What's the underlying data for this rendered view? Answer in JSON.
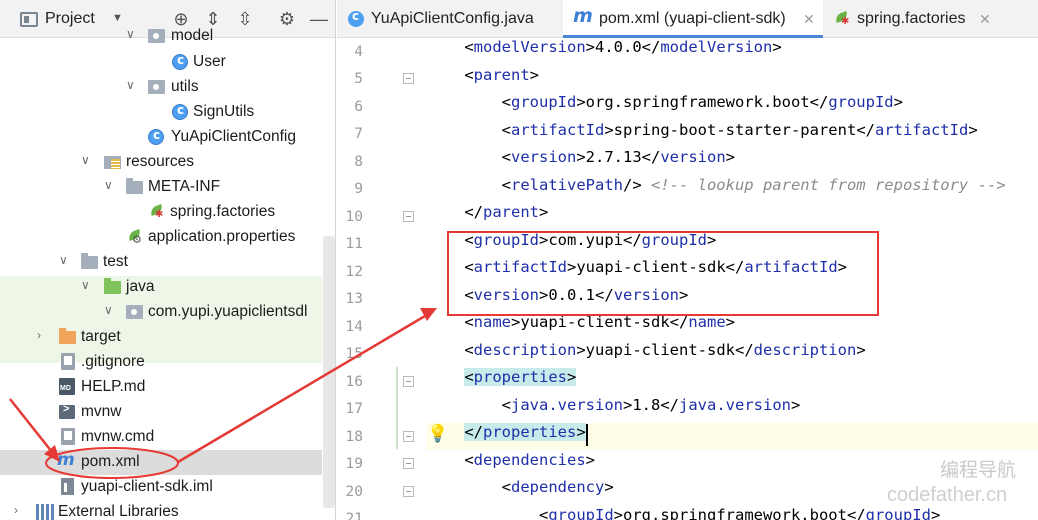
{
  "project_panel": {
    "title": "Project",
    "tree": [
      {
        "label": "model"
      },
      {
        "label": "User"
      },
      {
        "label": "utils"
      },
      {
        "label": "SignUtils"
      },
      {
        "label": "YuApiClientConfig"
      },
      {
        "label": "resources"
      },
      {
        "label": "META-INF"
      },
      {
        "label": "spring.factories"
      },
      {
        "label": "application.properties"
      },
      {
        "label": "test"
      },
      {
        "label": "java"
      },
      {
        "label": "com.yupi.yuapiclientsdl"
      },
      {
        "label": "target"
      },
      {
        "label": ".gitignore"
      },
      {
        "label": "HELP.md"
      },
      {
        "label": "mvnw"
      },
      {
        "label": "mvnw.cmd"
      },
      {
        "label": "pom.xml"
      },
      {
        "label": "yuapi-client-sdk.iml"
      },
      {
        "label": "External Libraries"
      }
    ]
  },
  "tabs": [
    {
      "label": "YuApiClientConfig.java"
    },
    {
      "label": "pom.xml (yuapi-client-sdk)"
    },
    {
      "label": "spring.factories"
    }
  ],
  "editor": {
    "line_numbers": [
      "4",
      "5",
      "6",
      "7",
      "8",
      "9",
      "10",
      "11",
      "12",
      "13",
      "14",
      "15",
      "16",
      "17",
      "18",
      "19",
      "20",
      "21"
    ],
    "code": {
      "l4": {
        "tag": "modelVersion",
        "val": "4.0.0"
      },
      "l5": {
        "tag": "parent"
      },
      "l6": {
        "tag": "groupId",
        "val": "org.springframework.boot"
      },
      "l7": {
        "tag": "artifactId",
        "val": "spring-boot-starter-parent"
      },
      "l8": {
        "tag": "version",
        "val": "2.7.13"
      },
      "l9": {
        "tag": "relativePath",
        "comment": "<!-- lookup parent from repository -->"
      },
      "l10": {
        "tag": "parent"
      },
      "l11": {
        "tag": "groupId",
        "val": "com.yupi"
      },
      "l12": {
        "tag": "artifactId",
        "val": "yuapi-client-sdk"
      },
      "l13": {
        "tag": "version",
        "val": "0.0.1"
      },
      "l14": {
        "tag": "name",
        "val": "yuapi-client-sdk"
      },
      "l15": {
        "tag": "description",
        "val": "yuapi-client-sdk"
      },
      "l16": {
        "tag": "properties"
      },
      "l17": {
        "tag": "java.version",
        "val": "1.8"
      },
      "l18": {
        "tag": "properties"
      },
      "l19": {
        "tag": "dependencies"
      },
      "l20": {
        "tag": "dependency"
      },
      "l21": {
        "tag": "groupId",
        "val": "org.springframework.boot"
      }
    }
  },
  "watermark": {
    "cn": "编程导航",
    "en": "codefather.cn"
  },
  "colors": {
    "tag": "#1f2fa8",
    "annotation": "#e53935",
    "selection": "#dcdcdc",
    "tab_underline": "#4a86d8"
  }
}
